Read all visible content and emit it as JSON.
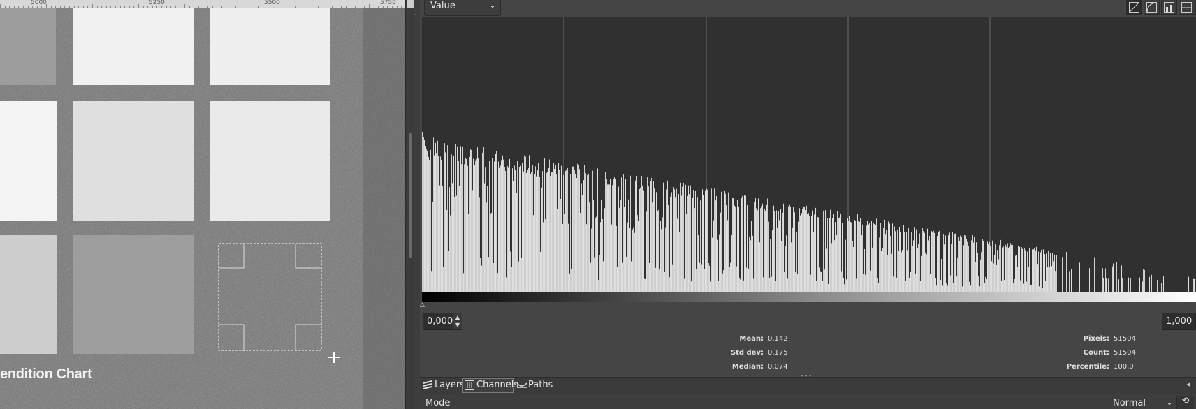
{
  "ruler": {
    "labels": [
      "5000",
      "5250",
      "5500",
      "5750"
    ]
  },
  "canvas": {
    "overlay_text": "endition Chart"
  },
  "histogram": {
    "channel": "Value",
    "range_start": "0,000",
    "range_end": "1,000",
    "scale_buttons": [
      "linear-histogram-icon",
      "logarithmic-histogram-icon",
      "per-channel-view-icon",
      "combined-view-icon"
    ]
  },
  "stats": {
    "left": [
      {
        "label": "Mean:",
        "value": "0,142"
      },
      {
        "label": "Std dev:",
        "value": "0,175"
      },
      {
        "label": "Median:",
        "value": "0,074"
      }
    ],
    "right": [
      {
        "label": "Pixels:",
        "value": "51504"
      },
      {
        "label": "Count:",
        "value": "51504"
      },
      {
        "label": "Percentile:",
        "value": "100,0"
      }
    ]
  },
  "tabs": [
    {
      "label": "Layers",
      "icon": "layers-icon"
    },
    {
      "label": "Channels",
      "icon": "channels-icon"
    },
    {
      "label": "Paths",
      "icon": "paths-icon"
    }
  ],
  "layer_mode": {
    "label": "Mode",
    "value": "Normal"
  },
  "colors": {
    "panel_bg": "#454545",
    "histogram_bg": "#303030",
    "histogram_fill": "#dedede"
  }
}
